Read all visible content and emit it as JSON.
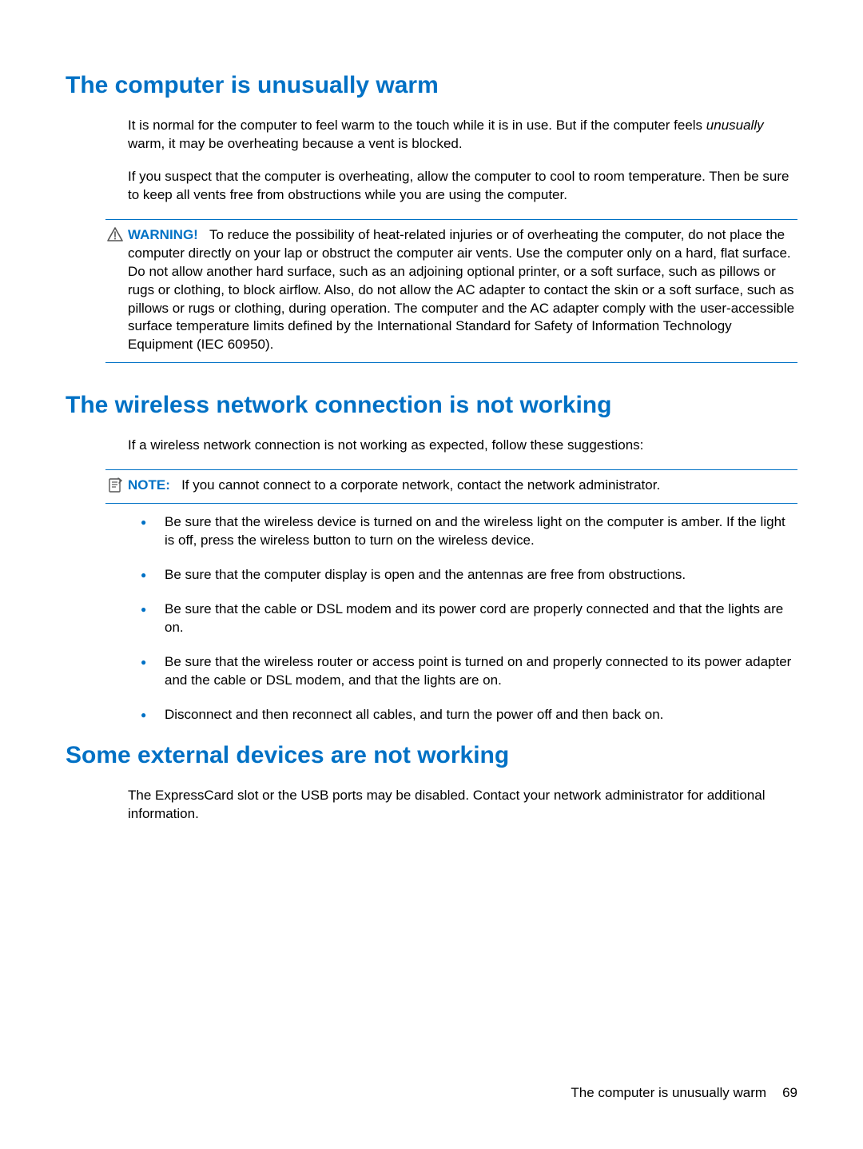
{
  "section1": {
    "title": "The computer is unusually warm",
    "para1_prefix": "It is normal for the computer to feel warm to the touch while it is in use. But if the computer feels ",
    "para1_italic": "unusually",
    "para1_suffix": " warm, it may be overheating because a vent is blocked.",
    "para2": "If you suspect that the computer is overheating, allow the computer to cool to room temperature. Then be sure to keep all vents free from obstructions while you are using the computer.",
    "warning_label": "WARNING!",
    "warning_text": "To reduce the possibility of heat-related injuries or of overheating the computer, do not place the computer directly on your lap or obstruct the computer air vents. Use the computer only on a hard, flat surface. Do not allow another hard surface, such as an adjoining optional printer, or a soft surface, such as pillows or rugs or clothing, to block airflow. Also, do not allow the AC adapter to contact the skin or a soft surface, such as pillows or rugs or clothing, during operation. The computer and the AC adapter comply with the user-accessible surface temperature limits defined by the International Standard for Safety of Information Technology Equipment (IEC 60950)."
  },
  "section2": {
    "title": "The wireless network connection is not working",
    "para1": "If a wireless network connection is not working as expected, follow these suggestions:",
    "note_label": "NOTE:",
    "note_text": "If you cannot connect to a corporate network, contact the network administrator.",
    "bullets": [
      "Be sure that the wireless device is turned on and the wireless light on the computer is amber. If the light is off, press the wireless button to turn on the wireless device.",
      "Be sure that the computer display is open and the antennas are free from obstructions.",
      "Be sure that the cable or DSL modem and its power cord are properly connected and that the lights are on.",
      "Be sure that the wireless router or access point is turned on and properly connected to its power adapter and the cable or DSL modem, and that the lights are on.",
      "Disconnect and then reconnect all cables, and turn the power off and then back on."
    ]
  },
  "section3": {
    "title": "Some external devices are not working",
    "para1": "The ExpressCard slot or the USB ports may be disabled. Contact your network administrator for additional information."
  },
  "footer": {
    "running_head": "The computer is unusually warm",
    "page_number": "69"
  }
}
